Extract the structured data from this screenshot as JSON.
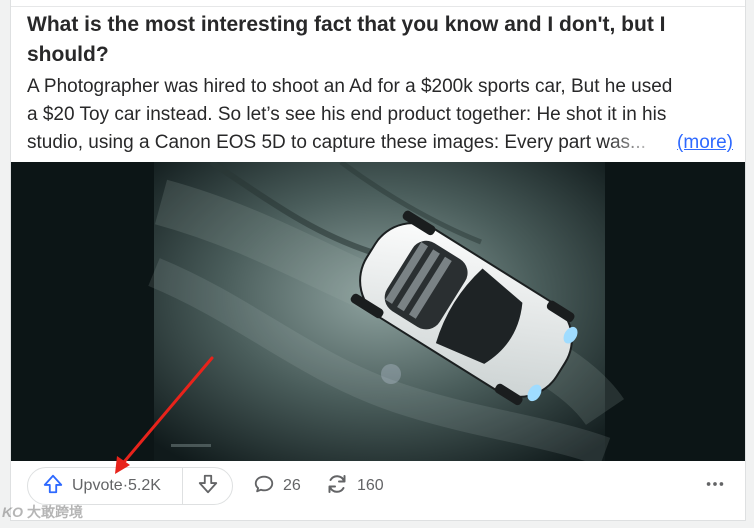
{
  "post": {
    "question": "What is the most interesting fact that you know and I don't, but I should?",
    "body_lines": [
      "A Photographer was hired to shoot an Ad for a $200k sports car, But he used",
      "a $20 Toy car instead. So let’s see his end product together: He shot it in his",
      "studio, using a Canon EOS 5D to capture these images: Every part was..."
    ],
    "more_label": "(more)"
  },
  "actions": {
    "upvote_label": "Upvote",
    "upvote_separator": " · ",
    "upvote_count": "5.2K",
    "comments_count": "26",
    "shares_count": "160"
  },
  "icons": {
    "upvote": "arrow-up-outline-icon",
    "downvote": "arrow-down-outline-icon",
    "comment": "speech-bubble-icon",
    "share": "refresh-arrows-icon",
    "more": "horizontal-ellipsis-icon"
  },
  "colors": {
    "upvote_accent": "#2e69ff",
    "link": "#2e69ff",
    "annotation_arrow": "#e8231b",
    "text_secondary": "#636466"
  },
  "watermark": {
    "logo": "KO",
    "text": "大敢跨境"
  }
}
